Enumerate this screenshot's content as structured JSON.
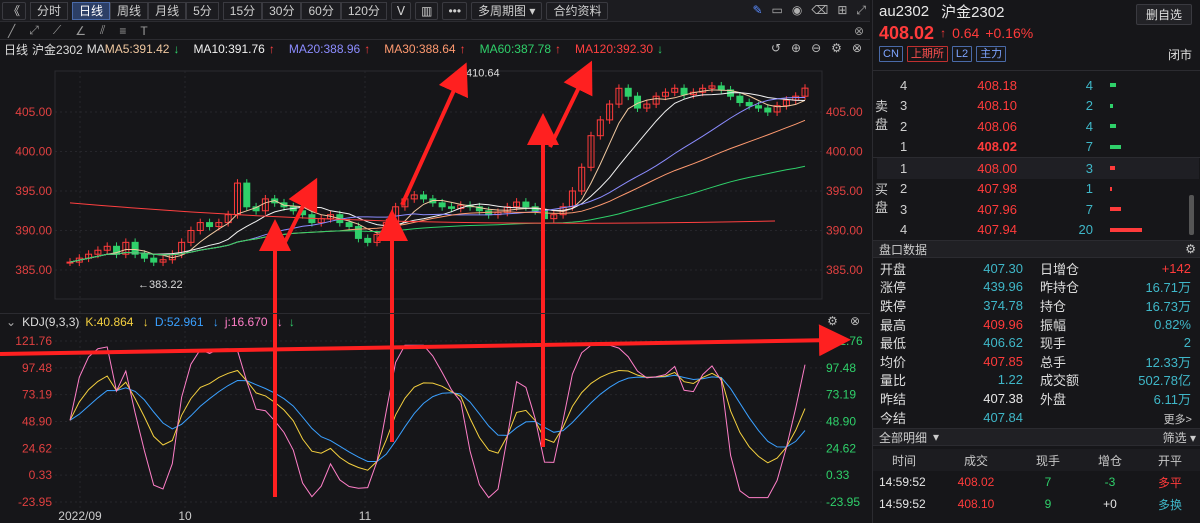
{
  "toolbar": {
    "back": "《",
    "items": [
      "分时",
      "日线",
      "周线",
      "月线",
      "5分",
      "15分",
      "30分",
      "60分",
      "120分"
    ],
    "active": 1,
    "more": "•••",
    "multi": "多周期图",
    "contract": "合约资料"
  },
  "legend": {
    "period": "日线",
    "name": "沪金2302",
    "ma_label": "MA",
    "ma": [
      {
        "t": "MA5:391.42",
        "a": "↓",
        "c": "#f0c8a0"
      },
      {
        "t": "MA10:391.76",
        "a": "↑",
        "c": "#f2f2f2"
      },
      {
        "t": "MA20:388.96",
        "a": "↑",
        "c": "#8c8cff"
      },
      {
        "t": "MA30:388.64",
        "a": "↑",
        "c": "#ff9a70"
      },
      {
        "t": "MA60:387.78",
        "a": "↑",
        "c": "#2fd06a"
      },
      {
        "t": "MA120:392.30",
        "a": "↓",
        "c": "#ff4040"
      }
    ]
  },
  "kdj": {
    "name": "KDJ(9,3,3)",
    "k": "K:40.864",
    "d": "D:52.961",
    "j": "j:16.670"
  },
  "price_axis": [
    "405.00",
    "400.00",
    "395.00",
    "390.00",
    "385.00"
  ],
  "kdj_axis": [
    "121.76",
    "97.48",
    "73.19",
    "48.90",
    "24.62",
    "0.33",
    "-23.95"
  ],
  "time_axis": [
    "2022/09",
    "10",
    "11"
  ],
  "hi_label": "410.64",
  "lo_label": "383.22",
  "right": {
    "code": "au2302",
    "name": "沪金2302",
    "del": "删自选",
    "price": "408.02",
    "arrow": "↑",
    "chg": "0.64",
    "pct": "+0.16%",
    "tags": [
      "CN",
      "上期所",
      "L2",
      "主力"
    ],
    "status": "闭市",
    "sell_label": "卖盘",
    "buy_label": "买盘",
    "asks": [
      {
        "lv": "4",
        "p": "408.18",
        "q": "4",
        "w": 6
      },
      {
        "lv": "3",
        "p": "408.10",
        "q": "2",
        "w": 3
      },
      {
        "lv": "2",
        "p": "408.06",
        "q": "4",
        "w": 6
      },
      {
        "lv": "1",
        "p": "408.02",
        "q": "7",
        "w": 11
      }
    ],
    "bids": [
      {
        "lv": "1",
        "p": "408.00",
        "q": "3",
        "w": 5
      },
      {
        "lv": "2",
        "p": "407.98",
        "q": "1",
        "w": 2
      },
      {
        "lv": "3",
        "p": "407.96",
        "q": "7",
        "w": 11
      },
      {
        "lv": "4",
        "p": "407.94",
        "q": "20",
        "w": 32
      }
    ],
    "panel_title": "盘口数据",
    "stats": [
      [
        "开盘",
        "407.30",
        "cyan",
        "日增仓",
        "+142",
        "red"
      ],
      [
        "涨停",
        "439.96",
        "cyan",
        "昨持仓",
        "16.71万",
        "cyan"
      ],
      [
        "跌停",
        "374.78",
        "cyan",
        "持仓",
        "16.73万",
        "cyan"
      ],
      [
        "最高",
        "409.96",
        "red",
        "振幅",
        "0.82%",
        "cyan"
      ],
      [
        "最低",
        "406.62",
        "cyan",
        "现手",
        "2",
        "cyan"
      ],
      [
        "均价",
        "407.85",
        "red",
        "总手",
        "12.33万",
        "cyan"
      ],
      [
        "量比",
        "1.22",
        "cyan",
        "成交额",
        "502.78亿",
        "cyan"
      ],
      [
        "昨结",
        "407.38",
        "white",
        "外盘",
        "6.11万",
        "cyan"
      ],
      [
        "今结",
        "407.84",
        "cyan",
        "",
        "",
        ""
      ]
    ],
    "more": "更多>",
    "detail": "全部明细",
    "filter": "筛选",
    "thead": [
      "时间",
      "成交",
      "现手",
      "增仓",
      "开平"
    ],
    "trades": [
      [
        "14:59:52",
        "408.02",
        "7",
        "-3",
        "多平"
      ],
      [
        "14:59:52",
        "408.10",
        "9",
        "+0",
        "多换"
      ]
    ]
  }
}
